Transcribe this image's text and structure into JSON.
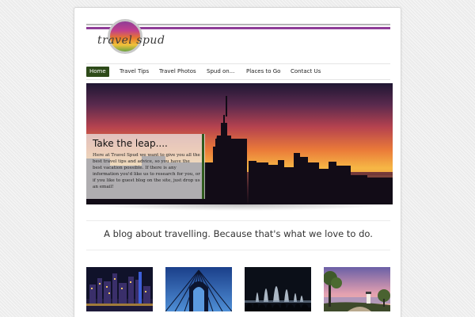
{
  "site": {
    "logo_text": "travel spud"
  },
  "nav": {
    "items": [
      {
        "label": "Home",
        "active": true
      },
      {
        "label": "Travel Tips",
        "active": false
      },
      {
        "label": "Travel Photos",
        "active": false
      },
      {
        "label": "Spud on...",
        "active": false
      },
      {
        "label": "Places to Go",
        "active": false
      },
      {
        "label": "Contact Us",
        "active": false
      }
    ]
  },
  "hero": {
    "title": "Take the leap....",
    "body": "Here at Travel Spud we want to give you all the best travel tips and advice, so you have the best vacation possible. If there is any information you'd like us to research for you, or if you like to guest blog on the site, just drop us an email!"
  },
  "tagline": "A blog about travelling. Because that's what we love to do.",
  "thumbnails": [
    {
      "subject": "city skyline at night"
    },
    {
      "subject": "bridge cables against blue sky"
    },
    {
      "subject": "fountain show at night"
    },
    {
      "subject": "lighthouse and trees at dusk"
    }
  ],
  "colors": {
    "brand_purple": "#8f3d98",
    "nav_active": "#2d4a19",
    "accent_green": "#2f5b1e"
  }
}
